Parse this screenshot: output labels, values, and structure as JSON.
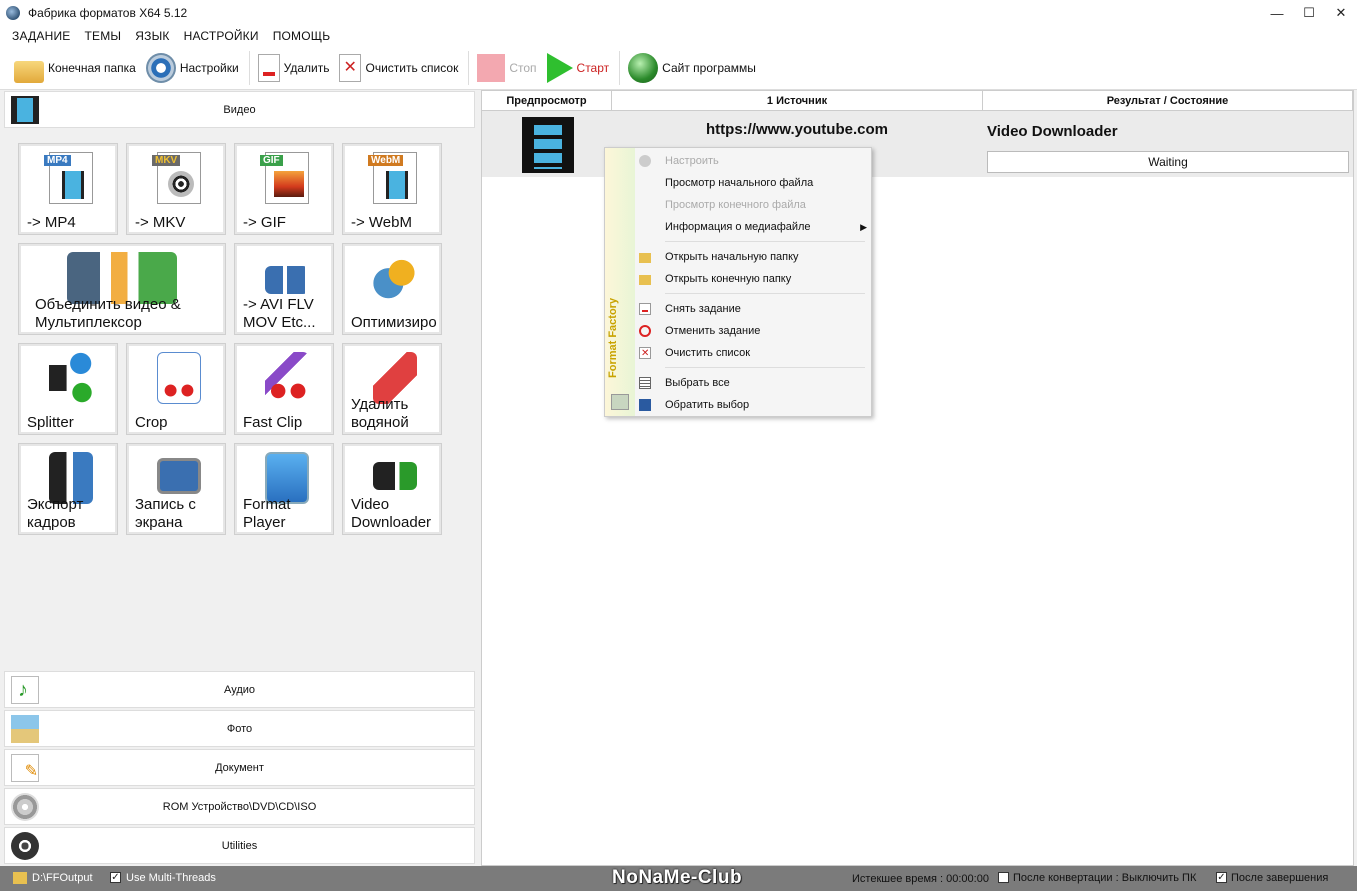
{
  "window": {
    "title": "Фабрика форматов X64 5.12",
    "controls": [
      "—",
      "☐",
      "✕"
    ]
  },
  "menu": [
    "ЗАДАНИЕ",
    "ТЕМЫ",
    "ЯЗЫК",
    "НАСТРОЙКИ",
    "ПОМОЩЬ"
  ],
  "toolbar": {
    "output_folder": "Конечная папка",
    "settings": "Настройки",
    "delete": "Удалить",
    "clear_list": "Очистить список",
    "stop": "Стоп",
    "start": "Старт",
    "website": "Сайт программы"
  },
  "categories": {
    "video": "Видео",
    "audio": "Аудио",
    "photo": "Фото",
    "document": "Документ",
    "rom": "ROM Устройство\\DVD\\CD\\ISO",
    "utilities": "Utilities"
  },
  "tiles": {
    "mp4": {
      "label": "-> MP4",
      "badge": "MP4",
      "badge_color": "#3a7ac0"
    },
    "mkv": {
      "label": "-> MKV",
      "badge": "MKV",
      "badge_color": "#6a6a6a"
    },
    "gif": {
      "label": "-> GIF",
      "badge": "GIF",
      "badge_color": "#3aa04a"
    },
    "webm": {
      "label": "-> WebM",
      "badge": "WebM",
      "badge_color": "#d07a20"
    },
    "merge": {
      "label": "Объединить видео &\nМультиплексор"
    },
    "avi": {
      "label": "-> AVI FLV\nMOV Etc..."
    },
    "optimize": {
      "label": "Оптимизиро"
    },
    "splitter": {
      "label": "Splitter"
    },
    "crop": {
      "label": "Crop"
    },
    "fastclip": {
      "label": "Fast Clip"
    },
    "watermark": {
      "label": "Удалить\nводяной"
    },
    "export": {
      "label": "Экспорт\nкадров"
    },
    "screenrec": {
      "label": "Запись с\nэкрана"
    },
    "player": {
      "label": "Format\nPlayer"
    },
    "downloader": {
      "label": "Video\nDownloader"
    }
  },
  "table": {
    "headers": [
      "Предпросмотр",
      "1 Источник",
      "Результат / Состояние"
    ],
    "rows": [
      {
        "source": "https://www.youtube.com",
        "result": "Video Downloader",
        "status": "Waiting"
      }
    ]
  },
  "context_menu": {
    "brand": "Format Factory",
    "items": [
      {
        "label": "Настроить",
        "disabled": true,
        "icon": "gear-icon"
      },
      {
        "label": "Просмотр начального файла",
        "disabled": false,
        "icon": ""
      },
      {
        "label": "Просмотр конечного файла",
        "disabled": true,
        "icon": ""
      },
      {
        "label": "Информация о медиафайле",
        "disabled": false,
        "icon": "",
        "submenu": true
      },
      {
        "label": "Открыть начальную папку",
        "disabled": false,
        "icon": "folder-icon"
      },
      {
        "label": "Открыть конечную папку",
        "disabled": false,
        "icon": "folder-icon"
      },
      {
        "label": "Снять задание",
        "disabled": false,
        "icon": "delete-icon"
      },
      {
        "label": "Отменить задание",
        "disabled": false,
        "icon": "stop-icon"
      },
      {
        "label": "Очистить список",
        "disabled": false,
        "icon": "clear-icon"
      },
      {
        "label": "Выбрать все",
        "disabled": false,
        "icon": "select-all-icon"
      },
      {
        "label": "Обратить выбор",
        "disabled": false,
        "icon": "invert-icon"
      }
    ]
  },
  "statusbar": {
    "path": "D:\\FFOutput",
    "multithreads": "Use Multi-Threads",
    "multithreads_checked": "✓",
    "watermark": "NoNaMe-Club",
    "elapsed": "Истекшее время : 00:00:00",
    "after_conversion": "После конвертации : Выключить ПК",
    "after_done": "После завершения",
    "after_done_checked": "✓"
  }
}
